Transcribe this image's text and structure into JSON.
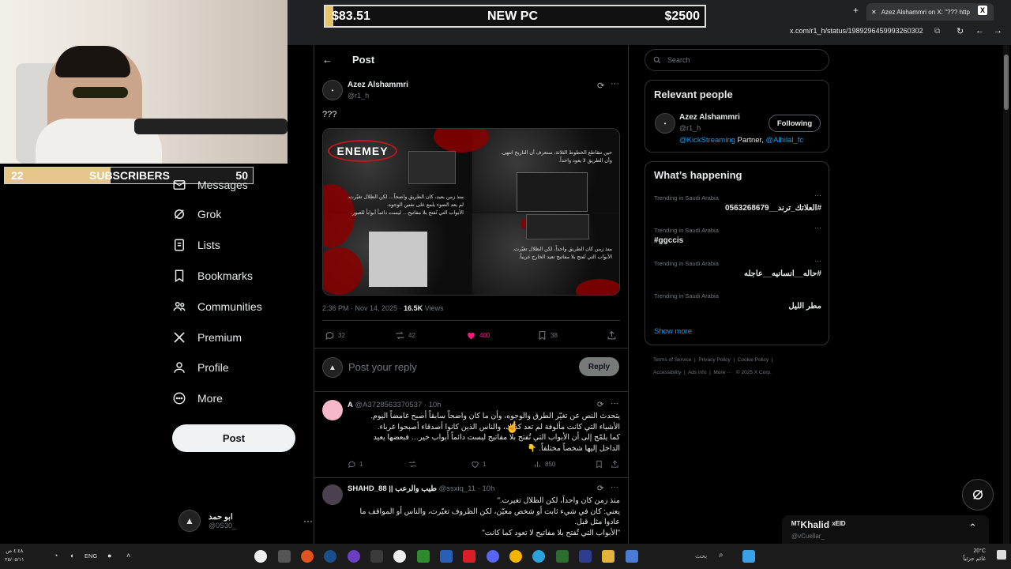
{
  "overlay": {
    "subscribers": {
      "current": "22",
      "label": "SUBSCRIBERS",
      "goal": "50"
    },
    "donation_goal": {
      "current": "$83.51",
      "label": "NEW PC",
      "target": "$2500"
    }
  },
  "browser": {
    "tab_title": "Azez Alshammri on X: \"??? http",
    "url": "x.com/r1_h/status/1989296459993260302"
  },
  "left_nav": {
    "items": [
      {
        "label": "Messages",
        "icon": "mail-icon"
      },
      {
        "label": "Grok",
        "icon": "grok-icon"
      },
      {
        "label": "Lists",
        "icon": "list-icon"
      },
      {
        "label": "Bookmarks",
        "icon": "bookmark-icon"
      },
      {
        "label": "Communities",
        "icon": "people-icon"
      },
      {
        "label": "Premium",
        "icon": "x-logo-icon"
      },
      {
        "label": "Profile",
        "icon": "person-icon"
      },
      {
        "label": "More",
        "icon": "more-circle-icon"
      }
    ],
    "post_button": "Post",
    "account": {
      "name": "ابو حمد",
      "handle": "@0S30_"
    }
  },
  "post_view": {
    "header_title": "Post",
    "author": {
      "name": "Azez Alshammri",
      "handle": "@r1_h"
    },
    "text": "???",
    "image_label": "ENEMEY",
    "timestamp": "2:36 PM · Nov 14, 2025 · ",
    "views_count": "16.5K",
    "views_label": " Views",
    "stats": {
      "replies": "32",
      "reposts": "42",
      "likes": "400",
      "bookmarks": "38"
    },
    "reply_placeholder": "Post your reply",
    "reply_button": "Reply"
  },
  "replies": [
    {
      "name": "A",
      "handle": "@A3728563370537",
      "time": "· 10h",
      "lines": [
        "يتحدث النص عن تغيّر الطرق والوجوه، وأن ما كان واضحاً سابقاً أصبح غامضاً اليوم.",
        "الأشياء التي كانت مألوفة لم تعد كذلك، والناس الذين كانوا أصدقاء أصبحوا غرباء.",
        "كما يلمّح إلى أن الأبواب التي تُفتح بلا مفاتيح ليست دائماً أبواب خير… فبعضها يعيد",
        "الداخل إليها شخصاً مختلفاً. 👇"
      ],
      "stats": {
        "replies": "1",
        "reposts": "",
        "likes": "1",
        "views": "850"
      }
    },
    {
      "name": "SHAHD_88 || طيب والرعب",
      "handle": "@ssxiq_11",
      "time": "· 10h",
      "lines": [
        "منذ زمن كان واحداً، لكن الظلال تغيرت.\"",
        "يعني: كان في شيء ثابت أو شخص معيّن، لكن الظروف تغيّرت، والناس أو المواقف ما",
        "عادوا مثل قبل.",
        "\"الأبواب التي تُفتح بلا مفاتيح لا تعود كما كانت\""
      ]
    }
  ],
  "sidebar": {
    "search_placeholder": "Search",
    "relevant_people": {
      "title": "Relevant people",
      "name": "Azez Alshammri",
      "handle": "@r1_h",
      "follow_button": "Following",
      "bio_link1": "@KickStreaming",
      "bio_mid": " Partner, ",
      "bio_link2": "@Alhilal_fc"
    },
    "whats_happening": {
      "title": "What’s happening",
      "trends": [
        {
          "context": "Trending in Saudi Arabia",
          "topic": "#العلاتك_ترند__0563268679"
        },
        {
          "context": "Trending in Saudi Arabia",
          "topic": "#ggccis"
        },
        {
          "context": "Trending in Saudi Arabia",
          "topic": "#حاله__انسانيه__عاجله"
        },
        {
          "context": "Trending in Saudi Arabia",
          "topic": "مطر الليل"
        }
      ],
      "show_more": "Show more"
    },
    "footer": {
      "row1": [
        "Terms of Service",
        "Privacy Policy",
        "Cookie Policy"
      ],
      "row2": [
        "Accessibility",
        "Ads info",
        "More ···",
        "© 2025 X Corp."
      ]
    }
  },
  "chat_popup": {
    "name": "ᴹᵀKhalid ˣᴱᴵᴰ",
    "handle": "@vCuellar_"
  },
  "taskbar": {
    "time": "٤:٤٨ ص",
    "date": "٢٥/٠٥/١١",
    "lang": "ENG",
    "weather_temp": "20°C",
    "weather_desc": "غائم جزئياً",
    "search_hint": "بحث"
  },
  "colors": {
    "like_pink": "#f91880",
    "link_blue": "#1d9bf0",
    "bg": "#000000"
  }
}
